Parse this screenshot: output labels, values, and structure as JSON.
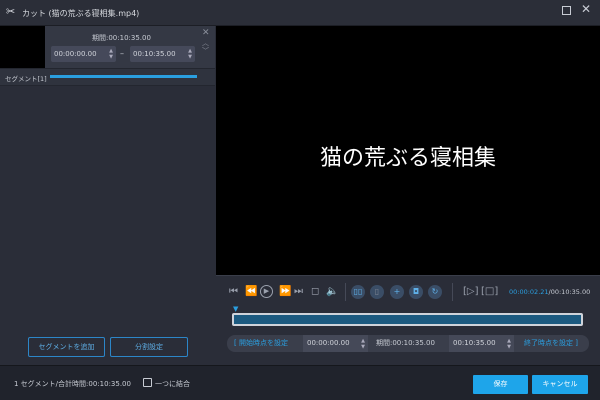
{
  "window": {
    "title": "カット (猫の荒ぶる寝相集.mp4)",
    "app_icon": "scissors-icon"
  },
  "segment_editor": {
    "duration_label": "期間:00:10:35.00",
    "start_time": "00:00:00.00",
    "end_time": "00:10:35.00",
    "separator": "–",
    "segment_label": "セグメント[1]"
  },
  "left_buttons": {
    "add_segment": "セグメントを追加",
    "split_settings": "分割設定"
  },
  "video": {
    "overlay_title": "猫の荒ぶる寝相集"
  },
  "playback": {
    "current_time": "00:00:02.21",
    "total_time": "/00:10:35.00",
    "progress": 0.0035
  },
  "trim_bar": {
    "set_start": "[ 開始時点を設定",
    "start_value": "00:00:00.00",
    "duration": "期間:00:10:35.00",
    "end_value": "00:10:35.00",
    "set_end": "終了時点を設定 ]"
  },
  "footer": {
    "summary": "1 セグメント/合計時間:00:10:35.00",
    "merge_label": "一つに結合",
    "merge_checked": false,
    "save": "保存",
    "cancel": "キャンセル"
  },
  "colors": {
    "accent": "#1ea5ea",
    "timeline": "#1c5a80"
  }
}
